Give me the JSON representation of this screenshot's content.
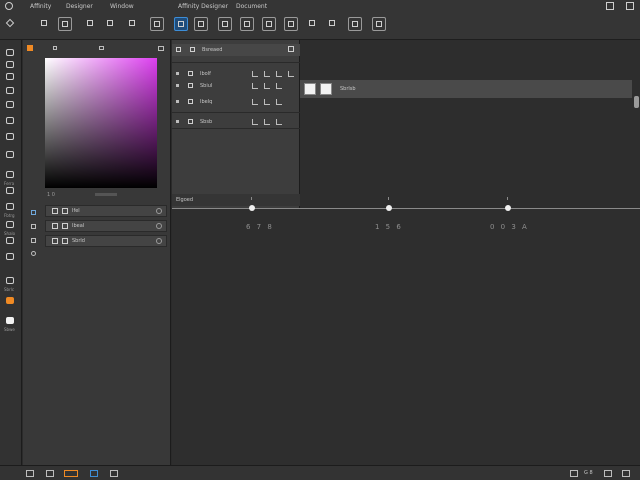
{
  "menu": {
    "items": [
      "Affinity",
      "Designer",
      "Window",
      "Affinity Designer",
      "Document"
    ]
  },
  "color_panel": {
    "tab_left": "",
    "tab_right": "",
    "hue_value": "1 0",
    "layers": [
      {
        "label": "Ifel"
      },
      {
        "label": "Ibeal"
      },
      {
        "label": "Sbrld"
      }
    ]
  },
  "fx_panel": {
    "title": "Bsreaed",
    "rows": [
      {
        "label": "Ibolf"
      },
      {
        "label": "Sbiul"
      },
      {
        "label": "Ibelq"
      },
      {
        "label": "Sbsb"
      }
    ],
    "footer": "Elgoed"
  },
  "canvas": {
    "swatch_label": "Sbrlsb"
  },
  "timeline": {
    "keyframes": [
      {
        "label": "6 7 8"
      },
      {
        "label": "1 5 6"
      },
      {
        "label": "0 0 3 A"
      }
    ]
  },
  "tools": {
    "captions": [
      "",
      "",
      "",
      "",
      "",
      "",
      "",
      "",
      "Ferra",
      "",
      "Fbtrg",
      "Shalo",
      "",
      "",
      "Sbrlc",
      "",
      "Sbwe"
    ]
  },
  "status": {
    "right_text": "G 8"
  },
  "colors": {
    "accent": "#3d8ed8",
    "gradient_hue": "#dd3ff0",
    "orange_tool": "#f08a24"
  }
}
